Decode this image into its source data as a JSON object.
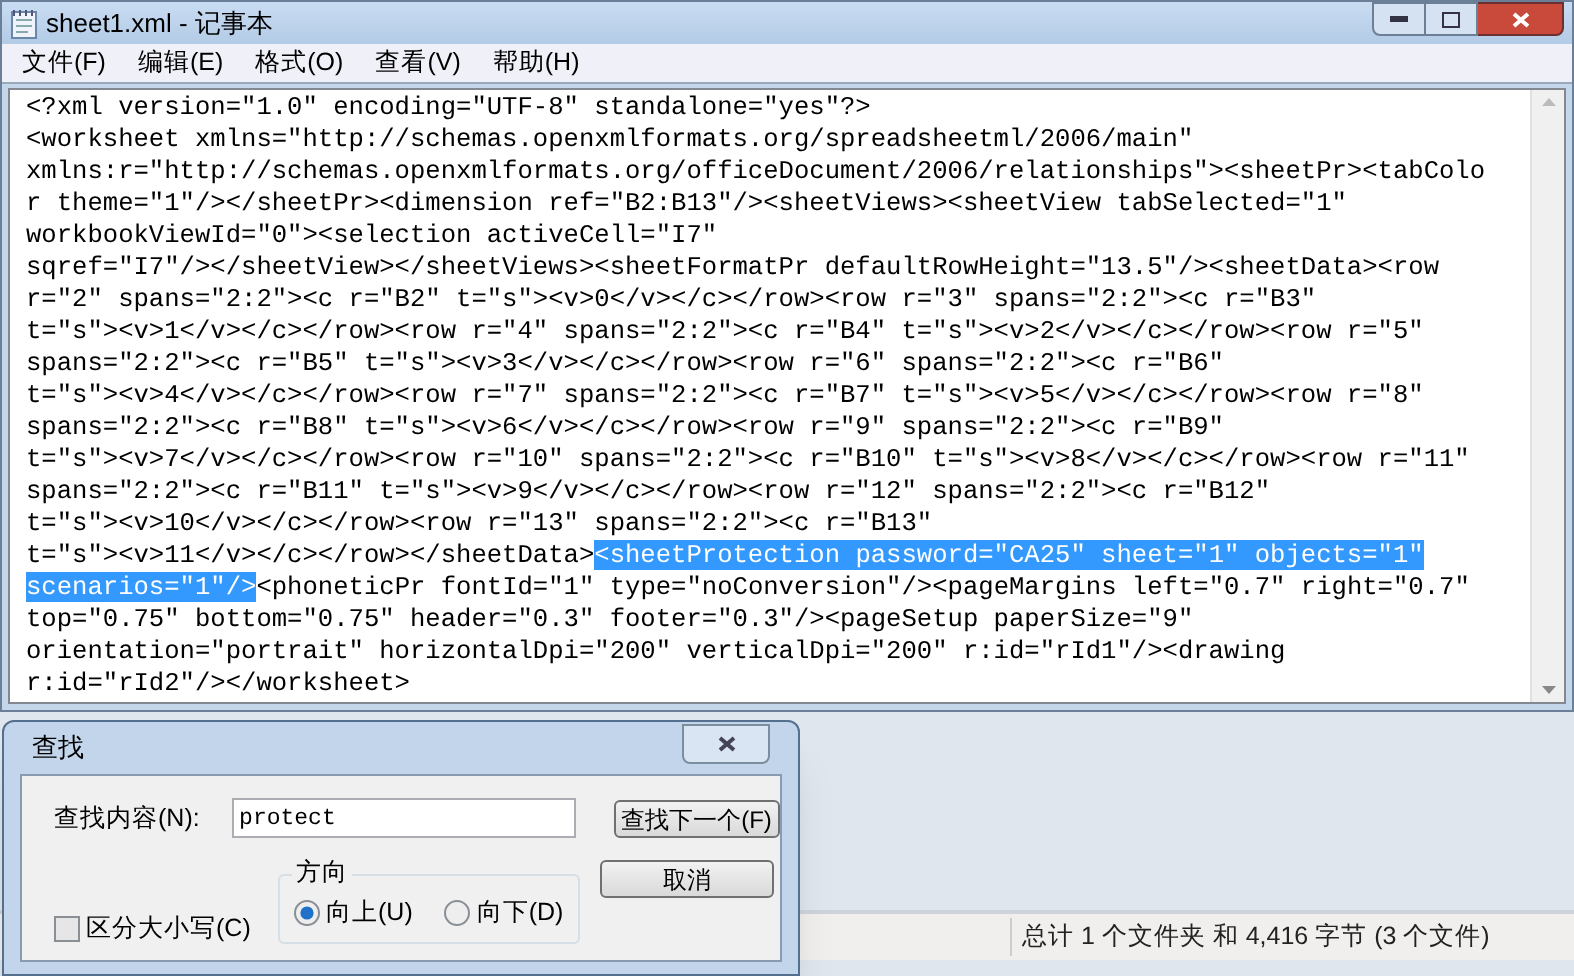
{
  "window": {
    "title": "sheet1.xml - 记事本"
  },
  "menu": [
    "文件(F)",
    "编辑(E)",
    "格式(O)",
    "查看(V)",
    "帮助(H)"
  ],
  "editor": {
    "lines": [
      [
        {
          "text": "<?xml version=\"1.0\" encoding=\"UTF-8\" standalone=\"yes\"?>",
          "selected": false
        }
      ],
      [
        {
          "text": "<worksheet xmlns=\"http://schemas.openxmlformats.org/spreadsheetml/2006/main\"",
          "selected": false
        }
      ],
      [
        {
          "text": "xmlns:r=\"http://schemas.openxmlformats.org/officeDocument/2006/relationships\"><sheetPr><tabColo",
          "selected": false
        }
      ],
      [
        {
          "text": "r theme=\"1\"/></sheetPr><dimension ref=\"B2:B13\"/><sheetViews><sheetView tabSelected=\"1\"",
          "selected": false
        }
      ],
      [
        {
          "text": "workbookViewId=\"0\"><selection activeCell=\"I7\"",
          "selected": false
        }
      ],
      [
        {
          "text": "sqref=\"I7\"/></sheetView></sheetViews><sheetFormatPr defaultRowHeight=\"13.5\"/><sheetData><row",
          "selected": false
        }
      ],
      [
        {
          "text": "r=\"2\" spans=\"2:2\"><c r=\"B2\" t=\"s\"><v>0</v></c></row><row r=\"3\" spans=\"2:2\"><c r=\"B3\"",
          "selected": false
        }
      ],
      [
        {
          "text": "t=\"s\"><v>1</v></c></row><row r=\"4\" spans=\"2:2\"><c r=\"B4\" t=\"s\"><v>2</v></c></row><row r=\"5\"",
          "selected": false
        }
      ],
      [
        {
          "text": "spans=\"2:2\"><c r=\"B5\" t=\"s\"><v>3</v></c></row><row r=\"6\" spans=\"2:2\"><c r=\"B6\"",
          "selected": false
        }
      ],
      [
        {
          "text": "t=\"s\"><v>4</v></c></row><row r=\"7\" spans=\"2:2\"><c r=\"B7\" t=\"s\"><v>5</v></c></row><row r=\"8\"",
          "selected": false
        }
      ],
      [
        {
          "text": "spans=\"2:2\"><c r=\"B8\" t=\"s\"><v>6</v></c></row><row r=\"9\" spans=\"2:2\"><c r=\"B9\"",
          "selected": false
        }
      ],
      [
        {
          "text": "t=\"s\"><v>7</v></c></row><row r=\"10\" spans=\"2:2\"><c r=\"B10\" t=\"s\"><v>8</v></c></row><row r=\"11\"",
          "selected": false
        }
      ],
      [
        {
          "text": "spans=\"2:2\"><c r=\"B11\" t=\"s\"><v>9</v></c></row><row r=\"12\" spans=\"2:2\"><c r=\"B12\"",
          "selected": false
        }
      ],
      [
        {
          "text": "t=\"s\"><v>10</v></c></row><row r=\"13\" spans=\"2:2\"><c r=\"B13\"",
          "selected": false
        }
      ],
      [
        {
          "text": "t=\"s\"><v>11</v></c></row></sheetData>",
          "selected": false
        },
        {
          "text": "<sheetProtection password=\"CA25\" sheet=\"1\" objects=\"1\"",
          "selected": true
        }
      ],
      [
        {
          "text": "scenarios=\"1\"/>",
          "selected": true
        },
        {
          "text": "<phoneticPr fontId=\"1\" type=\"noConversion\"/><pageMargins left=\"0.7\" right=\"0.7\"",
          "selected": false
        }
      ],
      [
        {
          "text": "top=\"0.75\" bottom=\"0.75\" header=\"0.3\" footer=\"0.3\"/><pageSetup paperSize=\"9\"",
          "selected": false
        }
      ],
      [
        {
          "text": "orientation=\"portrait\" horizontalDpi=\"200\" verticalDpi=\"200\" r:id=\"rId1\"/><drawing",
          "selected": false
        }
      ],
      [
        {
          "text": "r:id=\"rId2\"/></worksheet>",
          "selected": false
        }
      ]
    ]
  },
  "find_dialog": {
    "title": "查找",
    "find_label": "查找内容(N):",
    "find_value": "protect",
    "find_next_button": "查找下一个(F)",
    "cancel_button": "取消",
    "direction_label": "方向",
    "directions": [
      {
        "label": "向上(U)",
        "selected": true
      },
      {
        "label": "向下(D)",
        "selected": false
      }
    ],
    "match_case": {
      "label": "区分大小写(C)",
      "checked": false
    }
  },
  "explorer_status": "总计 1 个文件夹 和 4,416 字节 (3 个文件)"
}
